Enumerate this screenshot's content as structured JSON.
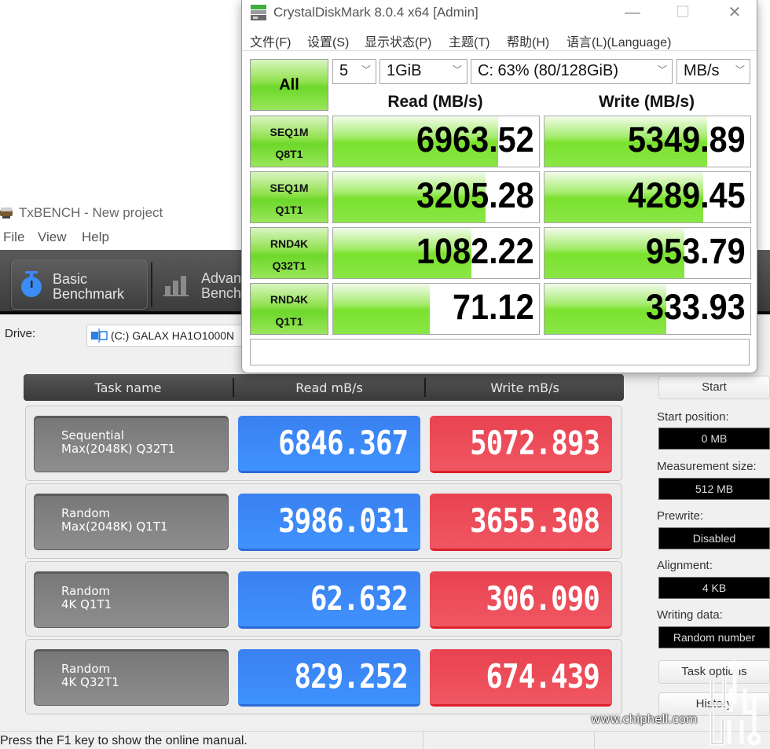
{
  "txbench": {
    "title": "TxBENCH - New project",
    "menu": [
      "File",
      "View",
      "Help"
    ],
    "toolbar": {
      "basic_label_1": "Basic",
      "basic_label_2": "Benchmark",
      "advanced_label_1": "Advan",
      "advanced_label_2": "Bench"
    },
    "drive_label": "Drive:",
    "drive_value": "(C:) GALAX HA1O1000N",
    "table_headers": [
      "Task name",
      "Read mB/s",
      "Write mB/s"
    ],
    "rows": [
      {
        "task": "Sequential\nMax(2048K) Q32T1",
        "read": "6846.367",
        "write": "5072.893"
      },
      {
        "task": "Random\nMax(2048K) Q1T1",
        "read": "3986.031",
        "write": "3655.308"
      },
      {
        "task": "Random\n4K Q1T1",
        "read": "62.632",
        "write": "306.090"
      },
      {
        "task": "Random\n4K Q32T1",
        "read": "829.252",
        "write": "674.439"
      }
    ],
    "side": {
      "start_button": "Start",
      "start_position_label": "Start position:",
      "start_position_value": "0 MB",
      "measurement_size_label": "Measurement size:",
      "measurement_size_value": "512 MB",
      "prewrite_label": "Prewrite:",
      "prewrite_value": "Disabled",
      "alignment_label": "Alignment:",
      "alignment_value": "4 KB",
      "writing_data_label": "Writing data:",
      "writing_data_value": "Random number",
      "task_options_button": "Task options",
      "history_button": "History"
    },
    "status": "Press the F1 key to show the online manual.",
    "colors": {
      "read": "#3f8cff",
      "write": "#ec4b57"
    }
  },
  "crystaldiskmark": {
    "title": "CrystalDiskMark 8.0.4 x64 [Admin]",
    "window_buttons": {
      "minimize": "—",
      "maximize": "☐",
      "close": "✕"
    },
    "menu": [
      "文件(F)",
      "设置(S)",
      "显示状态(P)",
      "主题(T)",
      "帮助(H)",
      "语言(L)(Language)"
    ],
    "all_button": "All",
    "count": "5",
    "size": "1GiB",
    "drive": "C: 63% (80/128GiB)",
    "unit": "MB/s",
    "read_header": "Read (MB/s)",
    "write_header": "Write (MB/s)",
    "tests": [
      {
        "line1": "SEQ1M",
        "line2": "Q8T1",
        "read": "6963.52",
        "write": "5349.89",
        "read_fill": 0.8,
        "write_fill": 0.79
      },
      {
        "line1": "SEQ1M",
        "line2": "Q1T1",
        "read": "3205.28",
        "write": "4289.45",
        "read_fill": 0.74,
        "write_fill": 0.77
      },
      {
        "line1": "RND4K",
        "line2": "Q32T1",
        "read": "1082.22",
        "write": "953.79",
        "read_fill": 0.67,
        "write_fill": 0.68
      },
      {
        "line1": "RND4K",
        "line2": "Q1T1",
        "read": "71.12",
        "write": "333.93",
        "read_fill": 0.47,
        "write_fill": 0.59
      }
    ],
    "comment": "",
    "colors": {
      "accent_green": "#7be22e"
    }
  },
  "watermark": "www.chiphell.com"
}
